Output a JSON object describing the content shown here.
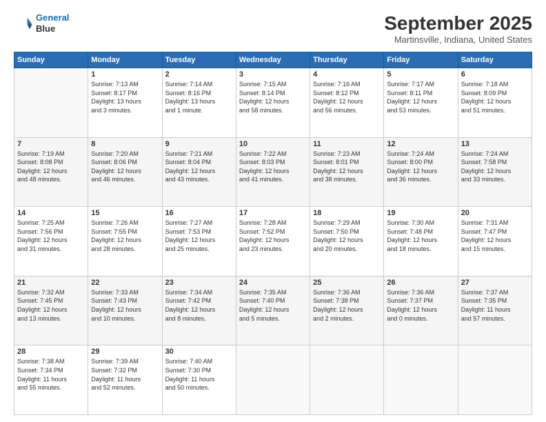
{
  "logo": {
    "line1": "General",
    "line2": "Blue"
  },
  "title": "September 2025",
  "subtitle": "Martinsville, Indiana, United States",
  "days_of_week": [
    "Sunday",
    "Monday",
    "Tuesday",
    "Wednesday",
    "Thursday",
    "Friday",
    "Saturday"
  ],
  "weeks": [
    [
      {
        "day": "",
        "info": ""
      },
      {
        "day": "1",
        "info": "Sunrise: 7:13 AM\nSunset: 8:17 PM\nDaylight: 13 hours\nand 3 minutes."
      },
      {
        "day": "2",
        "info": "Sunrise: 7:14 AM\nSunset: 8:16 PM\nDaylight: 13 hours\nand 1 minute."
      },
      {
        "day": "3",
        "info": "Sunrise: 7:15 AM\nSunset: 8:14 PM\nDaylight: 12 hours\nand 58 minutes."
      },
      {
        "day": "4",
        "info": "Sunrise: 7:16 AM\nSunset: 8:12 PM\nDaylight: 12 hours\nand 56 minutes."
      },
      {
        "day": "5",
        "info": "Sunrise: 7:17 AM\nSunset: 8:11 PM\nDaylight: 12 hours\nand 53 minutes."
      },
      {
        "day": "6",
        "info": "Sunrise: 7:18 AM\nSunset: 8:09 PM\nDaylight: 12 hours\nand 51 minutes."
      }
    ],
    [
      {
        "day": "7",
        "info": "Sunrise: 7:19 AM\nSunset: 8:08 PM\nDaylight: 12 hours\nand 48 minutes."
      },
      {
        "day": "8",
        "info": "Sunrise: 7:20 AM\nSunset: 8:06 PM\nDaylight: 12 hours\nand 46 minutes."
      },
      {
        "day": "9",
        "info": "Sunrise: 7:21 AM\nSunset: 8:04 PM\nDaylight: 12 hours\nand 43 minutes."
      },
      {
        "day": "10",
        "info": "Sunrise: 7:22 AM\nSunset: 8:03 PM\nDaylight: 12 hours\nand 41 minutes."
      },
      {
        "day": "11",
        "info": "Sunrise: 7:23 AM\nSunset: 8:01 PM\nDaylight: 12 hours\nand 38 minutes."
      },
      {
        "day": "12",
        "info": "Sunrise: 7:24 AM\nSunset: 8:00 PM\nDaylight: 12 hours\nand 36 minutes."
      },
      {
        "day": "13",
        "info": "Sunrise: 7:24 AM\nSunset: 7:58 PM\nDaylight: 12 hours\nand 33 minutes."
      }
    ],
    [
      {
        "day": "14",
        "info": "Sunrise: 7:25 AM\nSunset: 7:56 PM\nDaylight: 12 hours\nand 31 minutes."
      },
      {
        "day": "15",
        "info": "Sunrise: 7:26 AM\nSunset: 7:55 PM\nDaylight: 12 hours\nand 28 minutes."
      },
      {
        "day": "16",
        "info": "Sunrise: 7:27 AM\nSunset: 7:53 PM\nDaylight: 12 hours\nand 25 minutes."
      },
      {
        "day": "17",
        "info": "Sunrise: 7:28 AM\nSunset: 7:52 PM\nDaylight: 12 hours\nand 23 minutes."
      },
      {
        "day": "18",
        "info": "Sunrise: 7:29 AM\nSunset: 7:50 PM\nDaylight: 12 hours\nand 20 minutes."
      },
      {
        "day": "19",
        "info": "Sunrise: 7:30 AM\nSunset: 7:48 PM\nDaylight: 12 hours\nand 18 minutes."
      },
      {
        "day": "20",
        "info": "Sunrise: 7:31 AM\nSunset: 7:47 PM\nDaylight: 12 hours\nand 15 minutes."
      }
    ],
    [
      {
        "day": "21",
        "info": "Sunrise: 7:32 AM\nSunset: 7:45 PM\nDaylight: 12 hours\nand 13 minutes."
      },
      {
        "day": "22",
        "info": "Sunrise: 7:33 AM\nSunset: 7:43 PM\nDaylight: 12 hours\nand 10 minutes."
      },
      {
        "day": "23",
        "info": "Sunrise: 7:34 AM\nSunset: 7:42 PM\nDaylight: 12 hours\nand 8 minutes."
      },
      {
        "day": "24",
        "info": "Sunrise: 7:35 AM\nSunset: 7:40 PM\nDaylight: 12 hours\nand 5 minutes."
      },
      {
        "day": "25",
        "info": "Sunrise: 7:36 AM\nSunset: 7:38 PM\nDaylight: 12 hours\nand 2 minutes."
      },
      {
        "day": "26",
        "info": "Sunrise: 7:36 AM\nSunset: 7:37 PM\nDaylight: 12 hours\nand 0 minutes."
      },
      {
        "day": "27",
        "info": "Sunrise: 7:37 AM\nSunset: 7:35 PM\nDaylight: 11 hours\nand 57 minutes."
      }
    ],
    [
      {
        "day": "28",
        "info": "Sunrise: 7:38 AM\nSunset: 7:34 PM\nDaylight: 11 hours\nand 55 minutes."
      },
      {
        "day": "29",
        "info": "Sunrise: 7:39 AM\nSunset: 7:32 PM\nDaylight: 11 hours\nand 52 minutes."
      },
      {
        "day": "30",
        "info": "Sunrise: 7:40 AM\nSunset: 7:30 PM\nDaylight: 11 hours\nand 50 minutes."
      },
      {
        "day": "",
        "info": ""
      },
      {
        "day": "",
        "info": ""
      },
      {
        "day": "",
        "info": ""
      },
      {
        "day": "",
        "info": ""
      }
    ]
  ]
}
